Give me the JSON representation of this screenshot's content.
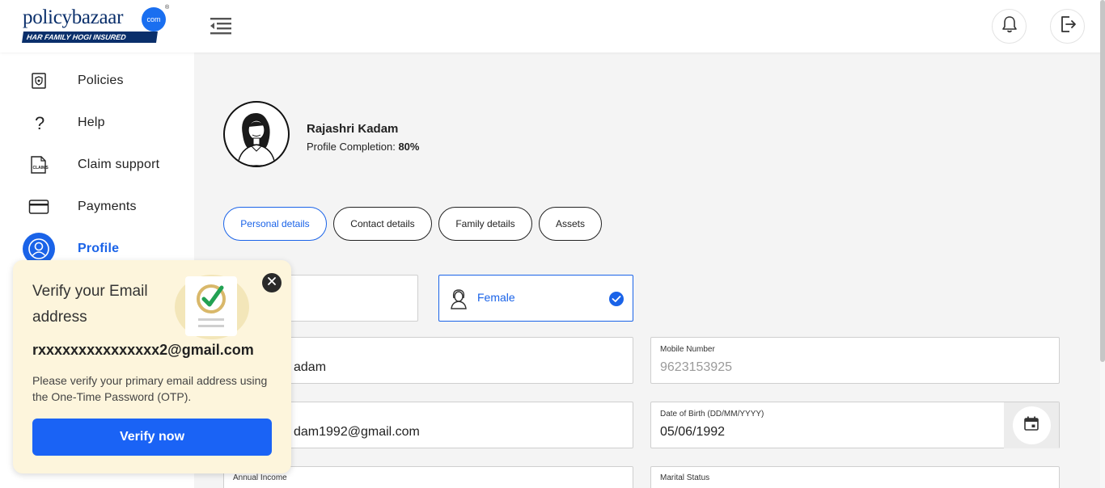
{
  "brand": {
    "logo_word": "policybazaar",
    "logo_suffix": "com",
    "logo_tagline": "HAR FAMILY HOGI INSURED"
  },
  "sidebar": {
    "items": [
      {
        "label": "Policies",
        "icon": "shield-doc-icon"
      },
      {
        "label": "Help",
        "icon": "question-icon"
      },
      {
        "label": "Claim support",
        "icon": "claims-doc-icon"
      },
      {
        "label": "Payments",
        "icon": "card-icon"
      },
      {
        "label": "Profile",
        "icon": "user-icon",
        "active": true
      }
    ]
  },
  "profile": {
    "name": "Rajashri Kadam",
    "completion_label": "Profile Completion:",
    "completion_value": "80%"
  },
  "tabs": [
    {
      "label": "Personal details",
      "active": true
    },
    {
      "label": "Contact details"
    },
    {
      "label": "Family details"
    },
    {
      "label": "Assets"
    }
  ],
  "form": {
    "gender_selected": "Female",
    "name_value_partial": "adam",
    "mobile_label": "Mobile Number",
    "mobile_value": "9623153925",
    "email_value_partial": "dam1992@gmail.com",
    "dob_label": "Date of Birth (DD/MM/YYYY)",
    "dob_value": "05/06/1992",
    "income_label": "Annual Income",
    "marital_label": "Marital Status"
  },
  "popup": {
    "title": "Verify your Email address",
    "email": "rxxxxxxxxxxxxxxx2@gmail.com",
    "description": "Please verify your primary email address using the One-Time Password (OTP).",
    "button": "Verify now"
  },
  "colors": {
    "accent": "#1a63e8",
    "navy": "#0a2f6b",
    "popup_bg": "#fdf5dc"
  }
}
